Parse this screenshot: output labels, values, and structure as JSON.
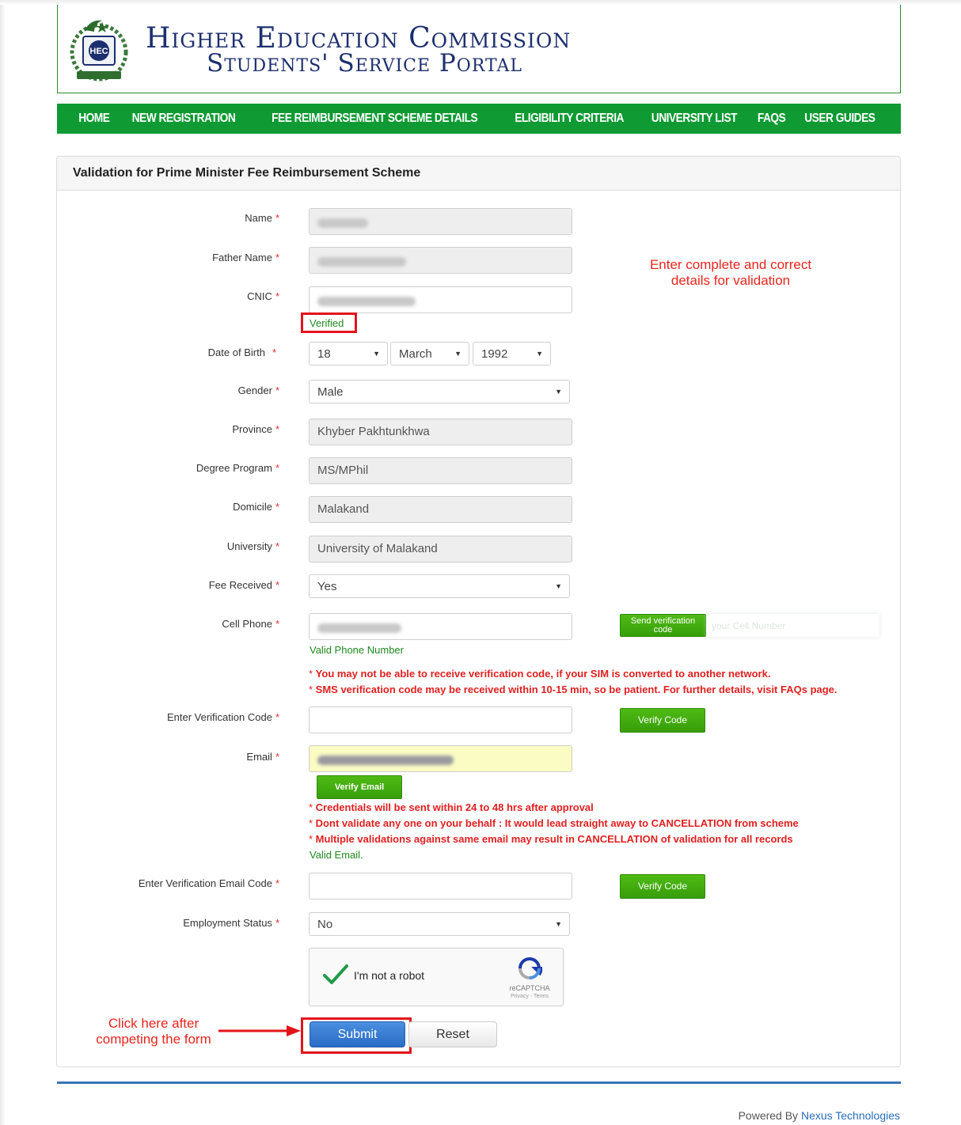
{
  "header": {
    "title_line1": "Higher Education Commission",
    "title_line2": "Students' Service Portal",
    "logo_text": "HEC"
  },
  "nav": [
    "HOME",
    "NEW REGISTRATION",
    "FEE REIMBURSEMENT SCHEME DETAILS",
    "ELIGIBILITY CRITERIA",
    "UNIVERSITY LIST",
    "FAQS",
    "USER GUIDES"
  ],
  "panel": {
    "title": "Validation for Prime Minister Fee Reimbursement Scheme"
  },
  "form": {
    "required_mark": "*",
    "labels": {
      "name": "Name",
      "father_name": "Father Name",
      "cnic": "CNIC",
      "dob": "Date of Birth",
      "gender": "Gender",
      "province": "Province",
      "degree_program": "Degree Program",
      "domicile": "Domicile",
      "university": "University",
      "fee_received": "Fee Received",
      "cell_phone": "Cell Phone",
      "verification_code": "Enter Verification Code",
      "email": "Email",
      "email_code": "Enter Verification Email Code",
      "employment_status": "Employment Status"
    },
    "cnic_status": "Verified",
    "dob": {
      "day": "18",
      "month": "March",
      "year": "1992"
    },
    "gender": "Male",
    "province": "Khyber Pakhtunkhwa",
    "degree_program": "MS/MPhil",
    "domicile": "Malakand",
    "university": "University of Malakand",
    "fee_received": "Yes",
    "send_code_label": "Send verification code",
    "phone_hint": "your Cell Number",
    "phone_status": "Valid Phone Number",
    "phone_warnings": [
      "You may not be able to receive verification code, if your SIM is converted to another network.",
      "SMS verification code may be received within 10-15 min, so be patient. For further details, visit FAQs page."
    ],
    "verify_code_label": "Verify Code",
    "verify_email_label": "Verify Email",
    "email_warnings": [
      "Credentials will be sent within 24 to 48 hrs after approval",
      "Dont validate any one on your behalf : It would lead straight away to CANCELLATION from scheme",
      "Multiple validations against same email may result in CANCELLATION of validation for all records"
    ],
    "email_status": "Valid Email.",
    "employment_status": "No"
  },
  "captcha": {
    "label": "I'm not a robot",
    "brand": "reCAPTCHA",
    "links": "Privacy - Terms"
  },
  "buttons": {
    "submit": "Submit",
    "reset": "Reset"
  },
  "annotations": {
    "top_note": "Enter complete and correct\ndetails for validation",
    "submit_note": "Click here after\ncompeting the form"
  },
  "footer": {
    "powered_by": "Powered By",
    "company": "Nexus Technologies"
  },
  "colors": {
    "nav_green": "#0f9a33",
    "brand_blue": "#1d2f6e",
    "button_green": "#43ab10",
    "submit_blue": "#2f74cc",
    "annotation_red": "#e8261e"
  }
}
